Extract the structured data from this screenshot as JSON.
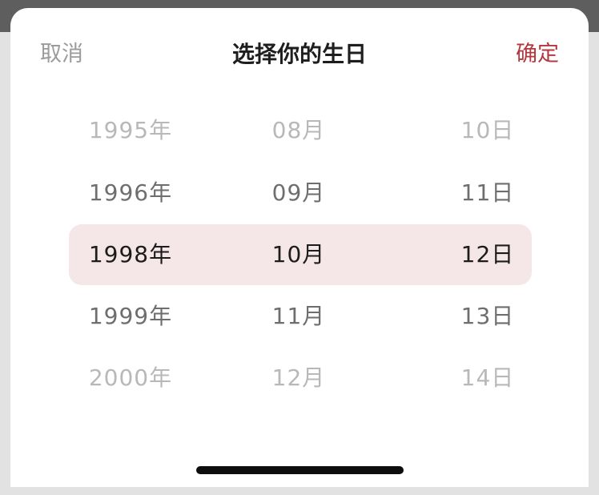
{
  "header": {
    "cancel_label": "取消",
    "title": "选择你的生日",
    "confirm_label": "确定"
  },
  "picker": {
    "years": [
      "1995年",
      "1996年",
      "1998年",
      "1999年",
      "2000年"
    ],
    "months": [
      "08月",
      "09月",
      "10月",
      "11月",
      "12月"
    ],
    "days": [
      "10日",
      "11日",
      "12日",
      "13日",
      "14日"
    ],
    "selected_index": 2
  },
  "colors": {
    "accent": "#b3373d",
    "selection_bg": "#f5e7e7"
  }
}
